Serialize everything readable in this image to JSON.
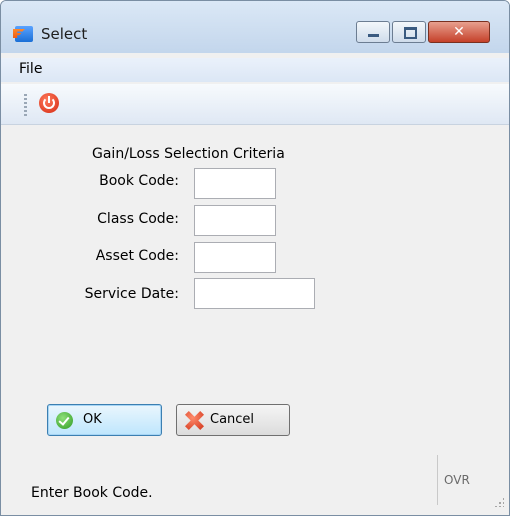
{
  "window": {
    "title": "Select"
  },
  "menu": {
    "items": [
      {
        "label": "File"
      }
    ]
  },
  "toolbar": {
    "buttons": [
      {
        "icon": "power-icon"
      }
    ]
  },
  "form": {
    "title": "Gain/Loss Selection Criteria",
    "fields": [
      {
        "label": "Book Code:",
        "value": ""
      },
      {
        "label": "Class Code:",
        "value": ""
      },
      {
        "label": "Asset Code:",
        "value": ""
      },
      {
        "label": "Service Date:",
        "value": ""
      }
    ]
  },
  "buttons": {
    "ok_label": "OK",
    "cancel_label": "Cancel"
  },
  "status": {
    "message": "Enter Book Code.",
    "mode": "OVR"
  },
  "colors": {
    "titlebar": "#c3d6ec",
    "close": "#c5412a",
    "ok_border": "#3c7fb1"
  }
}
